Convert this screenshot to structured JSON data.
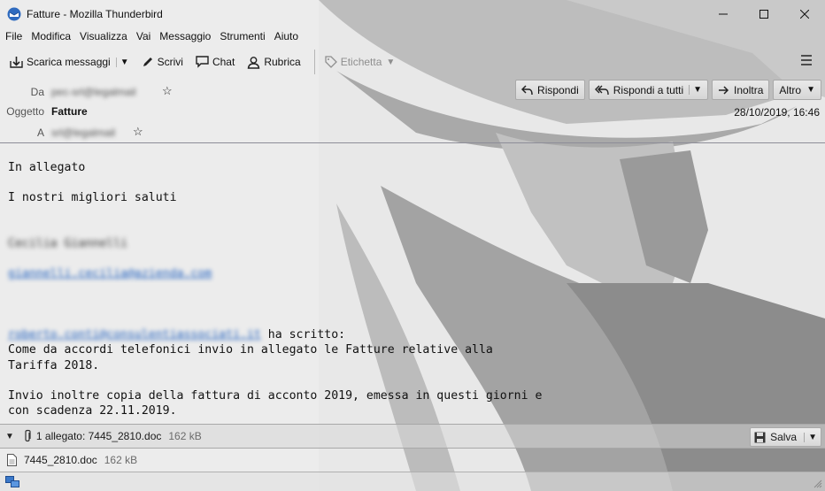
{
  "window": {
    "title": "Fatture - Mozilla Thunderbird",
    "controls": [
      "minimize-icon",
      "maximize-icon",
      "close-icon"
    ]
  },
  "menubar": {
    "items": [
      {
        "label": "File"
      },
      {
        "label": "Modifica"
      },
      {
        "label": "Visualizza"
      },
      {
        "label": "Vai"
      },
      {
        "label": "Messaggio"
      },
      {
        "label": "Strumenti"
      },
      {
        "label": "Aiuto"
      }
    ]
  },
  "toolbar": {
    "get_messages": "Scarica messaggi",
    "write": "Scrivi",
    "chat": "Chat",
    "address_book": "Rubrica",
    "tag": "Etichetta"
  },
  "header": {
    "from_label": "Da",
    "from_value": "pec-srl@legalmail",
    "subject_label": "Oggetto",
    "subject_value": "Fatture",
    "to_label": "A",
    "to_value": "srl@legalmail",
    "date": "28/10/2019, 16:46",
    "reply": "Rispondi",
    "reply_all": "Rispondi a tutti",
    "forward": "Inoltra",
    "more": "Altro"
  },
  "body": {
    "line1": "In allegato",
    "line2": "I nostri migliori saluti",
    "signature_name": "Cecilia Giannelli",
    "signature_email": "giannelli.cecilia@azienda.com",
    "quote_sender": "roberto.conti@consulentiassociati.it",
    "quote_intro": " ha scritto:",
    "quote_line1": "Come da accordi telefonici invio in allegato le Fatture relative alla",
    "quote_line2": "Tariffa 2018.",
    "quote_line3": "Invio inoltre copia della fattura di acconto 2019, emessa in questi giorni e",
    "quote_line4": "con scadenza 22.11.2019."
  },
  "attachments": {
    "summary": "1 allegato: 7445_2810.doc",
    "summary_size": "162 kB",
    "save": "Salva",
    "items": [
      {
        "name": "7445_2810.doc",
        "size": "162 kB"
      }
    ]
  },
  "colors": {
    "link": "#1e5fbf",
    "thunderbird_blue": "#2f6bbf"
  }
}
